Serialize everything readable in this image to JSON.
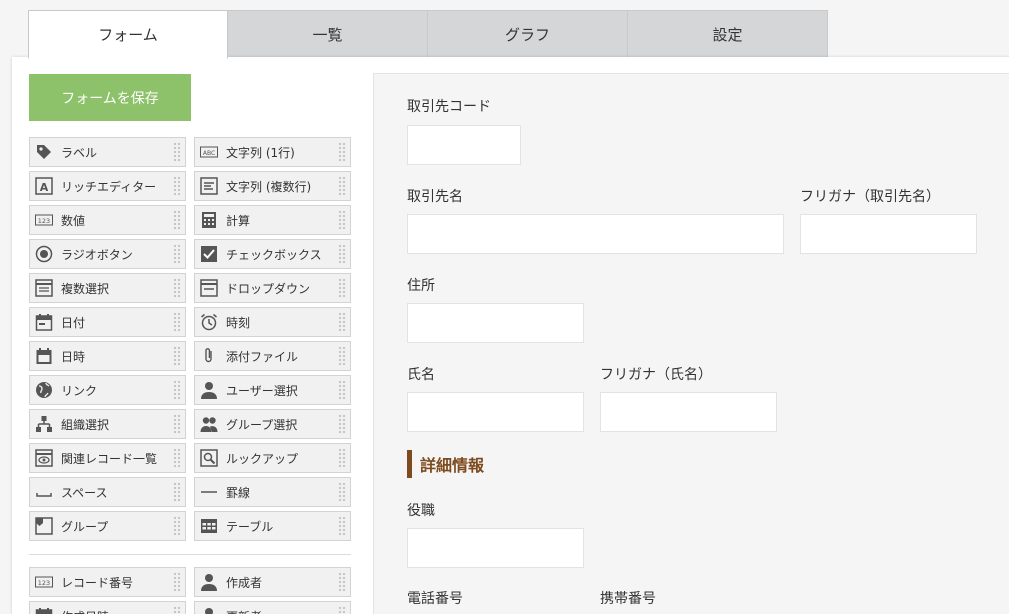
{
  "tabs": [
    "フォーム",
    "一覧",
    "グラフ",
    "設定"
  ],
  "save_button": "フォームを保存",
  "palette": {
    "rows": [
      [
        {
          "label": "ラベル",
          "icon": "tag-icon"
        },
        {
          "label": "文字列 (1行)",
          "icon": "abc-icon"
        }
      ],
      [
        {
          "label": "リッチエディター",
          "icon": "rich-editor-icon"
        },
        {
          "label": "文字列 (複数行)",
          "icon": "multiline-icon"
        }
      ],
      [
        {
          "label": "数値",
          "icon": "number-icon"
        },
        {
          "label": "計算",
          "icon": "calculator-icon"
        }
      ],
      [
        {
          "label": "ラジオボタン",
          "icon": "radio-icon"
        },
        {
          "label": "チェックボックス",
          "icon": "checkbox-icon"
        }
      ],
      [
        {
          "label": "複数選択",
          "icon": "multiselect-icon"
        },
        {
          "label": "ドロップダウン",
          "icon": "dropdown-icon"
        }
      ],
      [
        {
          "label": "日付",
          "icon": "date-icon"
        },
        {
          "label": "時刻",
          "icon": "clock-icon"
        }
      ],
      [
        {
          "label": "日時",
          "icon": "datetime-icon"
        },
        {
          "label": "添付ファイル",
          "icon": "paperclip-icon"
        }
      ],
      [
        {
          "label": "リンク",
          "icon": "globe-icon"
        },
        {
          "label": "ユーザー選択",
          "icon": "user-icon"
        }
      ],
      [
        {
          "label": "組織選択",
          "icon": "org-icon"
        },
        {
          "label": "グループ選択",
          "icon": "group-icon"
        }
      ],
      [
        {
          "label": "関連レコード一覧",
          "icon": "related-records-icon"
        },
        {
          "label": "ルックアップ",
          "icon": "lookup-icon"
        }
      ],
      [
        {
          "label": "スペース",
          "icon": "space-icon"
        },
        {
          "label": "罫線",
          "icon": "line-icon"
        }
      ],
      [
        {
          "label": "グループ",
          "icon": "field-group-icon"
        },
        {
          "label": "テーブル",
          "icon": "table-icon"
        }
      ]
    ],
    "system_rows": [
      [
        {
          "label": "レコード番号",
          "icon": "number-icon"
        },
        {
          "label": "作成者",
          "icon": "user-icon"
        }
      ],
      [
        {
          "label": "作成日時",
          "icon": "date-icon"
        },
        {
          "label": "更新者",
          "icon": "user-icon"
        }
      ]
    ]
  },
  "form": {
    "fields": [
      {
        "label": "取引先コード"
      },
      {
        "label": "取引先名"
      },
      {
        "label": "フリガナ（取引先名）"
      },
      {
        "label": "住所"
      },
      {
        "label": "氏名"
      },
      {
        "label": "フリガナ（氏名）"
      },
      {
        "label": "役職"
      },
      {
        "label": "電話番号"
      },
      {
        "label": "携帯番号"
      }
    ],
    "section_title": "詳細情報"
  },
  "colors": {
    "accent_green": "#8dc26a",
    "section_brown": "#7d4b1e"
  }
}
